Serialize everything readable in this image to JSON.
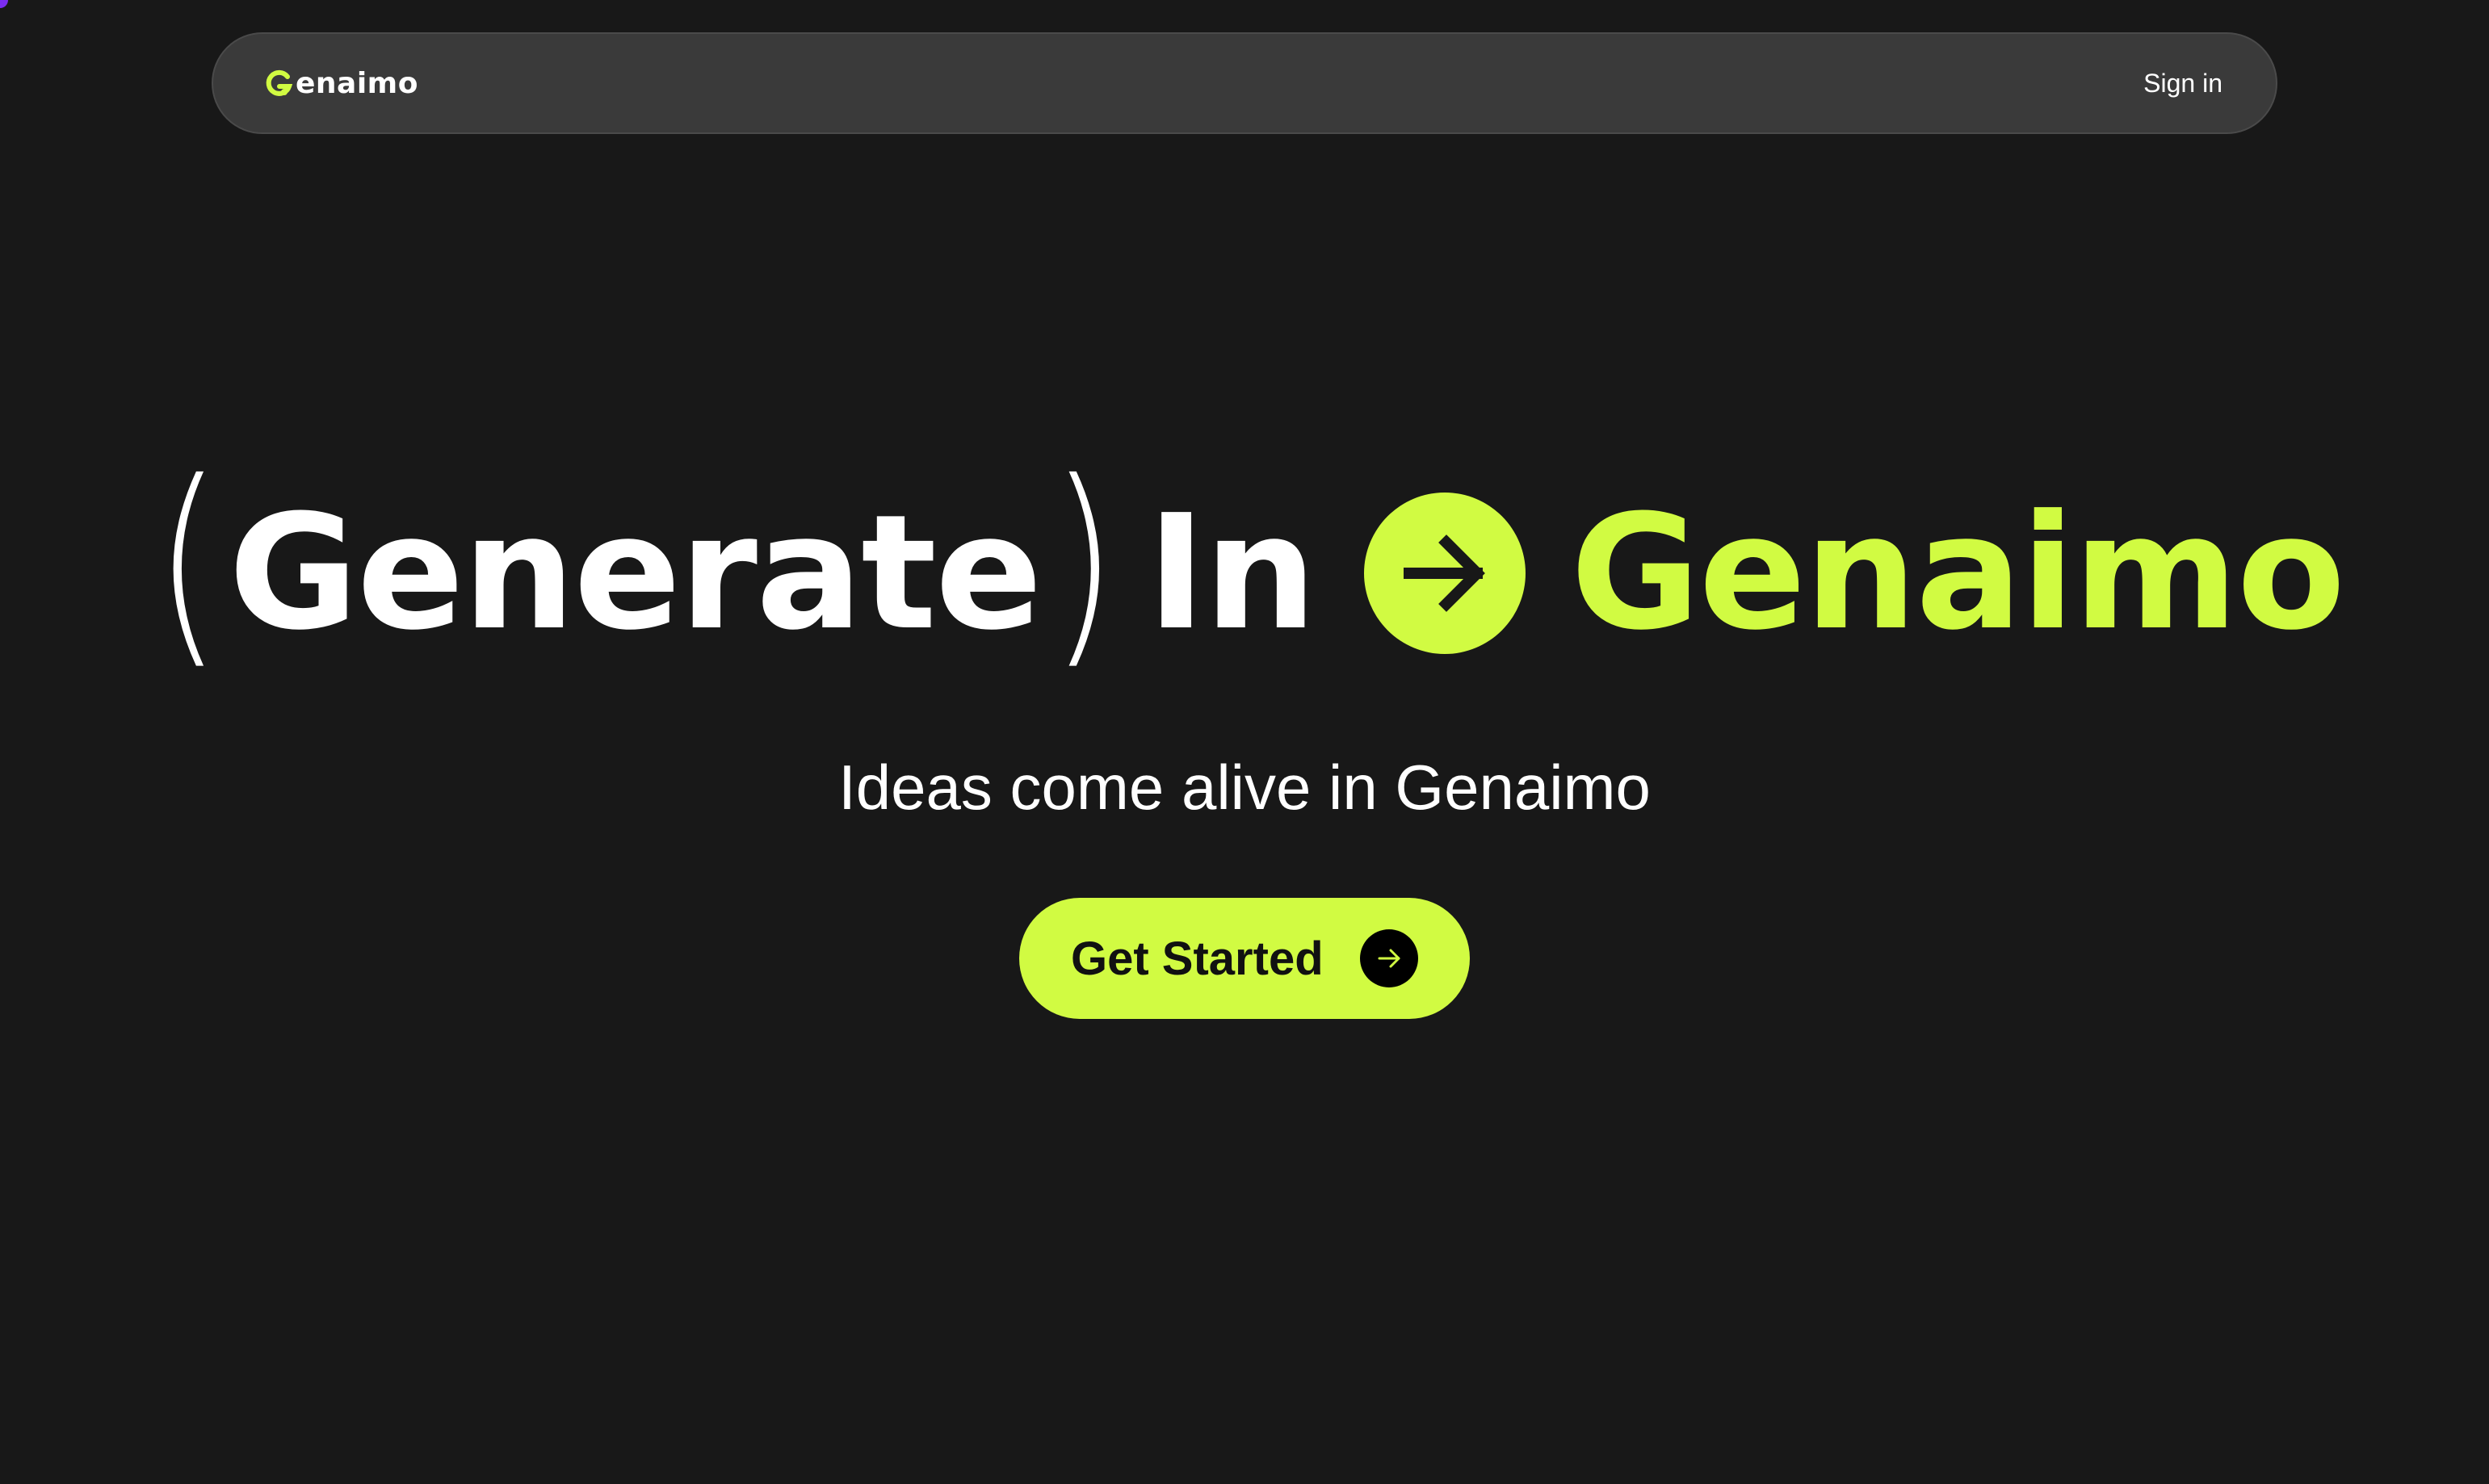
{
  "nav": {
    "logo_text": "enaimo",
    "logo_icon": "g-logo-mark",
    "signin_label": "Sign in"
  },
  "hero": {
    "open_paren": "(",
    "word_generate": "Generate",
    "close_paren": ")",
    "word_in": "In",
    "arrow_icon": "arrow-right-circle-icon",
    "word_brand": "Genaimo"
  },
  "subtitle": "Ideas come alive in Genaimo",
  "cta": {
    "label": "Get Started",
    "icon": "arrow-right-icon"
  },
  "colors": {
    "background": "#181818",
    "navbar": "#3a3a3a",
    "accent": "#d1fb42",
    "text": "#ffffff",
    "corner_accent": "#7b2cf0"
  }
}
